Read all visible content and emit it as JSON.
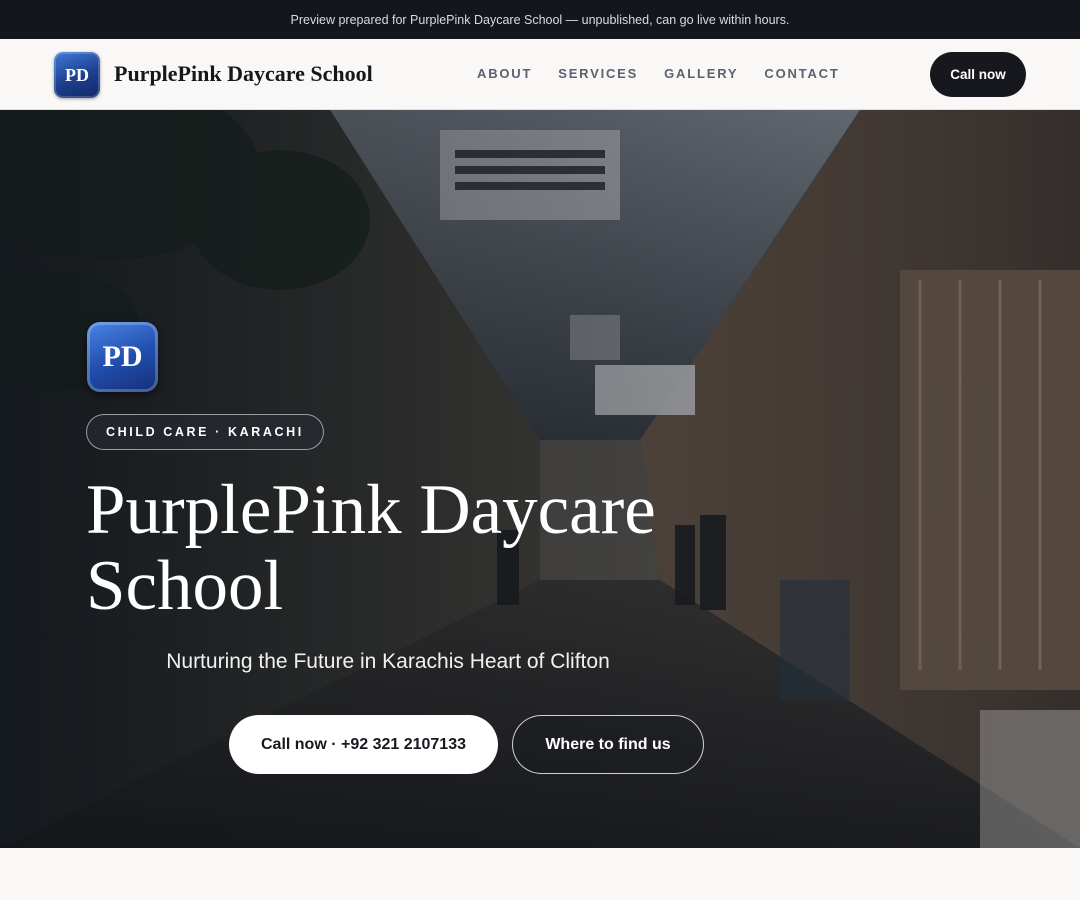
{
  "topbar": {
    "notice": "Preview prepared for PurplePink Daycare School — unpublished, can go live within hours."
  },
  "nav": {
    "logo_text": "PD",
    "brand_name": "PurplePink Daycare School",
    "links": [
      "ABOUT",
      "SERVICES",
      "GALLERY",
      "CONTACT"
    ],
    "cta_label": "Call now"
  },
  "hero": {
    "logo_text": "PD",
    "tag": "CHILD CARE · KARACHI",
    "title": "PurplePink Daycare School",
    "subtitle": "Nurturing the Future in Karachis Heart of Clifton",
    "primary_button": "Call now · +92 321 2107133",
    "secondary_button": "Where to find us"
  },
  "colors": {
    "topbar_bg": "#13161c",
    "nav_bg": "#f9f8f6",
    "cta_bg": "#16181d",
    "logo_blue": "#2250b0"
  }
}
